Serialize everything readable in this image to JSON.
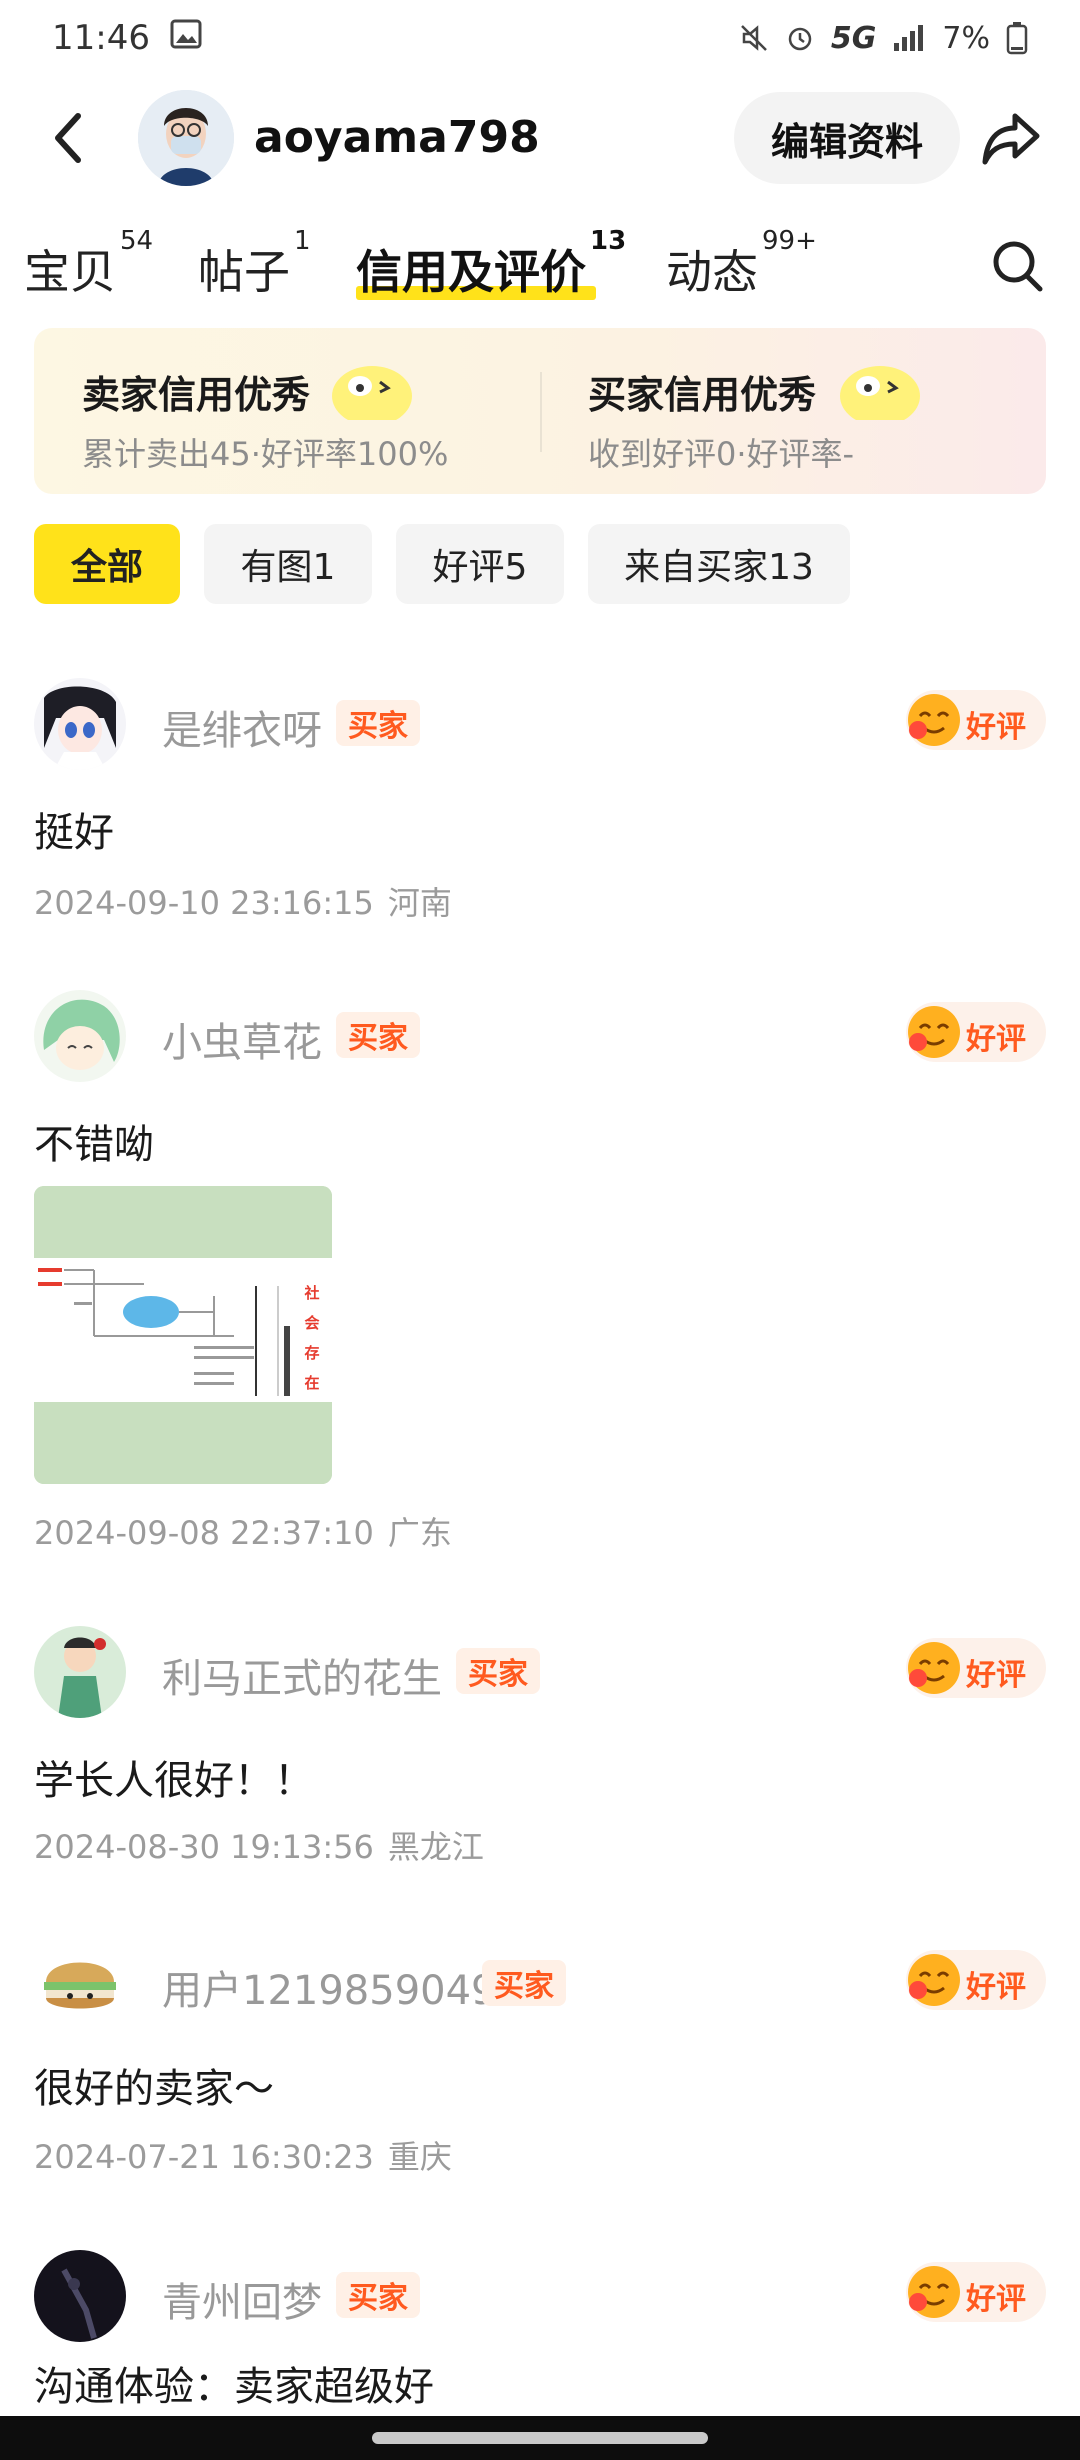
{
  "status_bar": {
    "time": "11:46",
    "battery": "7%",
    "network": "5G"
  },
  "header": {
    "username": "aoyama798",
    "edit_label": "编辑资料"
  },
  "tabs": [
    {
      "label": "宝贝",
      "count": "54"
    },
    {
      "label": "帖子",
      "count": "1"
    },
    {
      "label": "信用及评价",
      "count": "13"
    },
    {
      "label": "动态",
      "count": "99+"
    }
  ],
  "credit": {
    "seller_title": "卖家信用优秀",
    "seller_sub": "累计卖出45·好评率100%",
    "buyer_title": "买家信用优秀",
    "buyer_sub": "收到好评0·好评率-"
  },
  "filters": [
    {
      "label": "全部"
    },
    {
      "label": "有图1"
    },
    {
      "label": "好评5"
    },
    {
      "label": "来自买家13"
    }
  ],
  "reviews": [
    {
      "name": "是绯衣呀",
      "tag": "买家",
      "rating": "好评",
      "text": "挺好",
      "time": "2024-09-10 23:16:15",
      "region": "河南"
    },
    {
      "name": "小虫草花",
      "tag": "买家",
      "rating": "好评",
      "text": "不错呦",
      "time": "2024-09-08 22:37:10",
      "region": "广东",
      "image_text": [
        "社",
        "会",
        "存",
        "在"
      ]
    },
    {
      "name": "利马正式的花生",
      "tag": "买家",
      "rating": "好评",
      "text": "学长人很好！！",
      "time": "2024-08-30 19:13:56",
      "region": "黑龙江"
    },
    {
      "name": "用户1219859049",
      "tag": "买家",
      "rating": "好评",
      "text": "很好的卖家～",
      "time": "2024-07-21 16:30:23",
      "region": "重庆"
    },
    {
      "name": "青州回梦",
      "tag": "买家",
      "rating": "好评",
      "text": "沟通体验：卖家超级好"
    }
  ],
  "colors": {
    "accent_yellow": "#ffe21a",
    "tag_orange": "#ff5a1f"
  }
}
